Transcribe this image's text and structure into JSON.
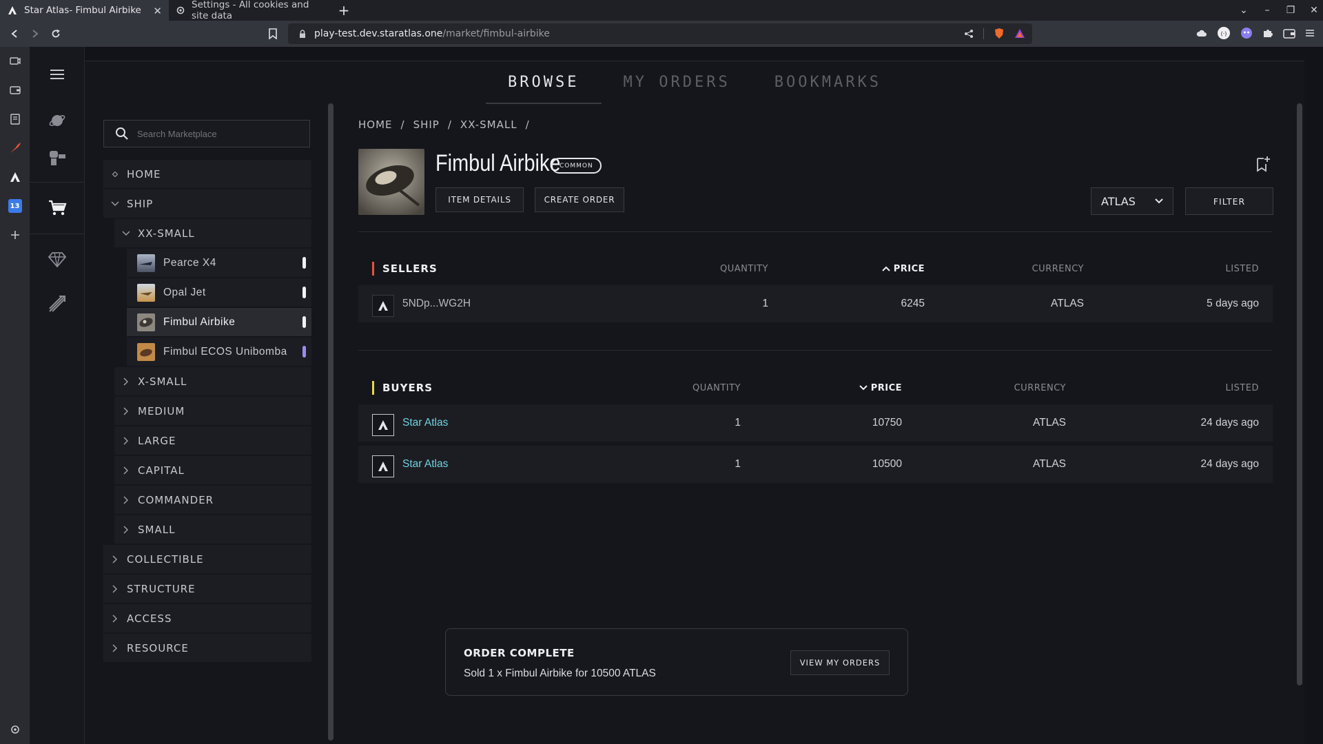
{
  "browser": {
    "tabs": [
      {
        "title": "Star Atlas- Fimbul Airbike",
        "active": true
      },
      {
        "title": "Settings - All cookies and site data",
        "active": false
      }
    ],
    "url_host": "play-test.dev.staratlas.one",
    "url_path": "/market/fimbul-airbike",
    "calendar_badge": "13"
  },
  "nav": {
    "tabs": [
      "BROWSE",
      "MY ORDERS",
      "BOOKMARKS"
    ],
    "active": "BROWSE"
  },
  "search": {
    "placeholder": "Search Marketplace"
  },
  "tree": {
    "home": "HOME",
    "ship": "SHIP",
    "xx_small": "XX-SMALL",
    "items": [
      {
        "name": "Pearce X4",
        "pill": "white"
      },
      {
        "name": "Opal Jet",
        "pill": "white"
      },
      {
        "name": "Fimbul Airbike",
        "pill": "white",
        "selected": true
      },
      {
        "name": "Fimbul ECOS Unibomba",
        "pill": "purple"
      }
    ],
    "ship_sizes": [
      "X-SMALL",
      "MEDIUM",
      "LARGE",
      "CAPITAL",
      "COMMANDER",
      "SMALL"
    ],
    "categories": [
      "COLLECTIBLE",
      "STRUCTURE",
      "ACCESS",
      "RESOURCE"
    ]
  },
  "breadcrumb": [
    "HOME",
    "SHIP",
    "XX-SMALL"
  ],
  "item": {
    "title": "Fimbul Airbike",
    "rarity": "COMMON",
    "details_label": "ITEM DETAILS",
    "create_order_label": "CREATE ORDER"
  },
  "currency_select": {
    "value": "ATLAS"
  },
  "filter_label": "FILTER",
  "sellers": {
    "title": "SELLERS",
    "headers": {
      "quantity": "QUANTITY",
      "price": "PRICE",
      "currency": "CURRENCY",
      "listed": "LISTED"
    },
    "accent": "#e8523a",
    "rows": [
      {
        "name": "5NDp...WG2H",
        "quantity": "1",
        "price": "6245",
        "currency": "ATLAS",
        "listed": "5 days ago"
      }
    ]
  },
  "buyers": {
    "title": "BUYERS",
    "headers": {
      "quantity": "QUANTITY",
      "price": "PRICE",
      "currency": "CURRENCY",
      "listed": "LISTED"
    },
    "accent": "#e8d84a",
    "rows": [
      {
        "name": "Star Atlas",
        "quantity": "1",
        "price": "10750",
        "currency": "ATLAS",
        "listed": "24 days ago"
      },
      {
        "name": "Star Atlas",
        "quantity": "1",
        "price": "10500",
        "currency": "ATLAS",
        "listed": "24 days ago"
      }
    ]
  },
  "toast": {
    "title": "ORDER COMPLETE",
    "message": "Sold 1 x Fimbul Airbike for 10500 ATLAS",
    "button": "VIEW MY ORDERS"
  }
}
